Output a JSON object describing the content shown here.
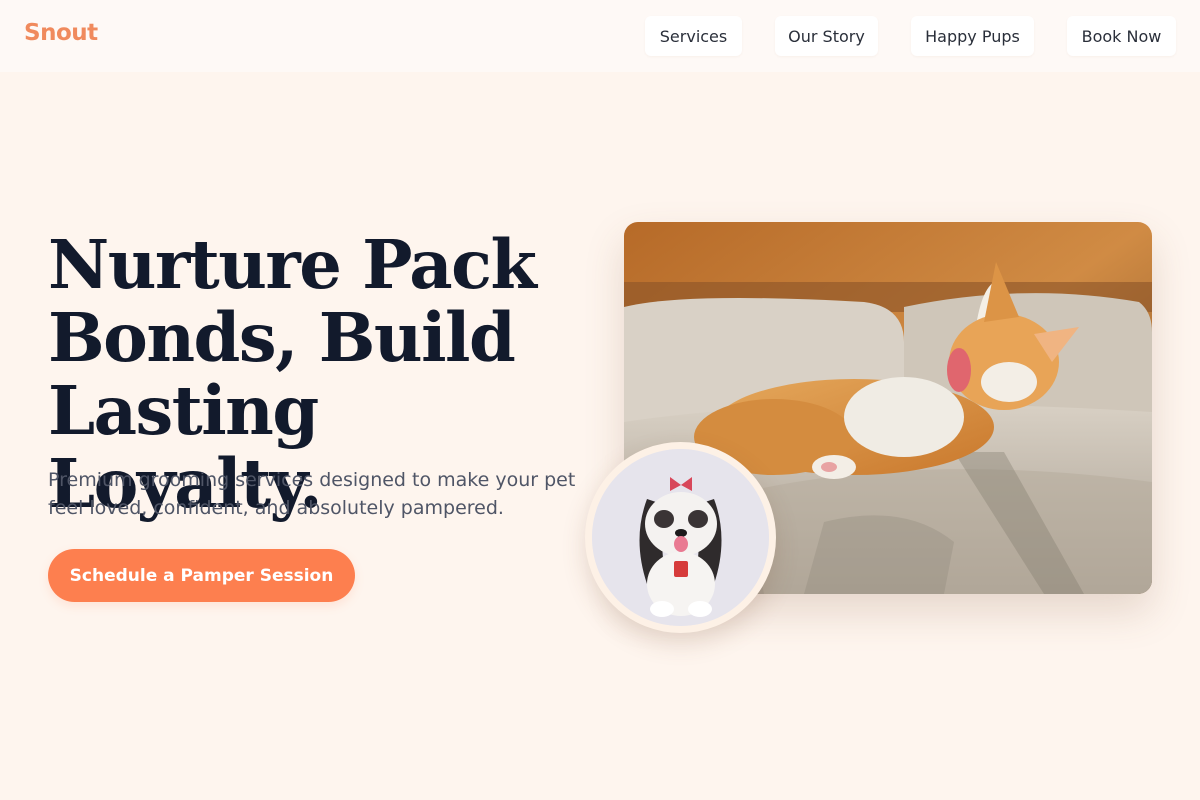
{
  "brand": {
    "name": "Snout",
    "color": "#f08a5d"
  },
  "nav": {
    "items": [
      {
        "label": "Services"
      },
      {
        "label": "Our Story"
      },
      {
        "label": "Happy Pups"
      },
      {
        "label": "Book Now"
      }
    ]
  },
  "hero": {
    "title_line1": "Nurture Pack",
    "title_line2": "Bonds, Build",
    "title_line3": "Lasting Loyalty.",
    "subtitle": "Premium grooming services designed to make your pet feel loved, confident, and absolutely pampered.",
    "cta_label": "Schedule a Pamper Session"
  },
  "colors": {
    "background": "#fef5ee",
    "accent": "#fd7f4f",
    "heading": "#121a2c",
    "body_text": "#4f5566"
  }
}
